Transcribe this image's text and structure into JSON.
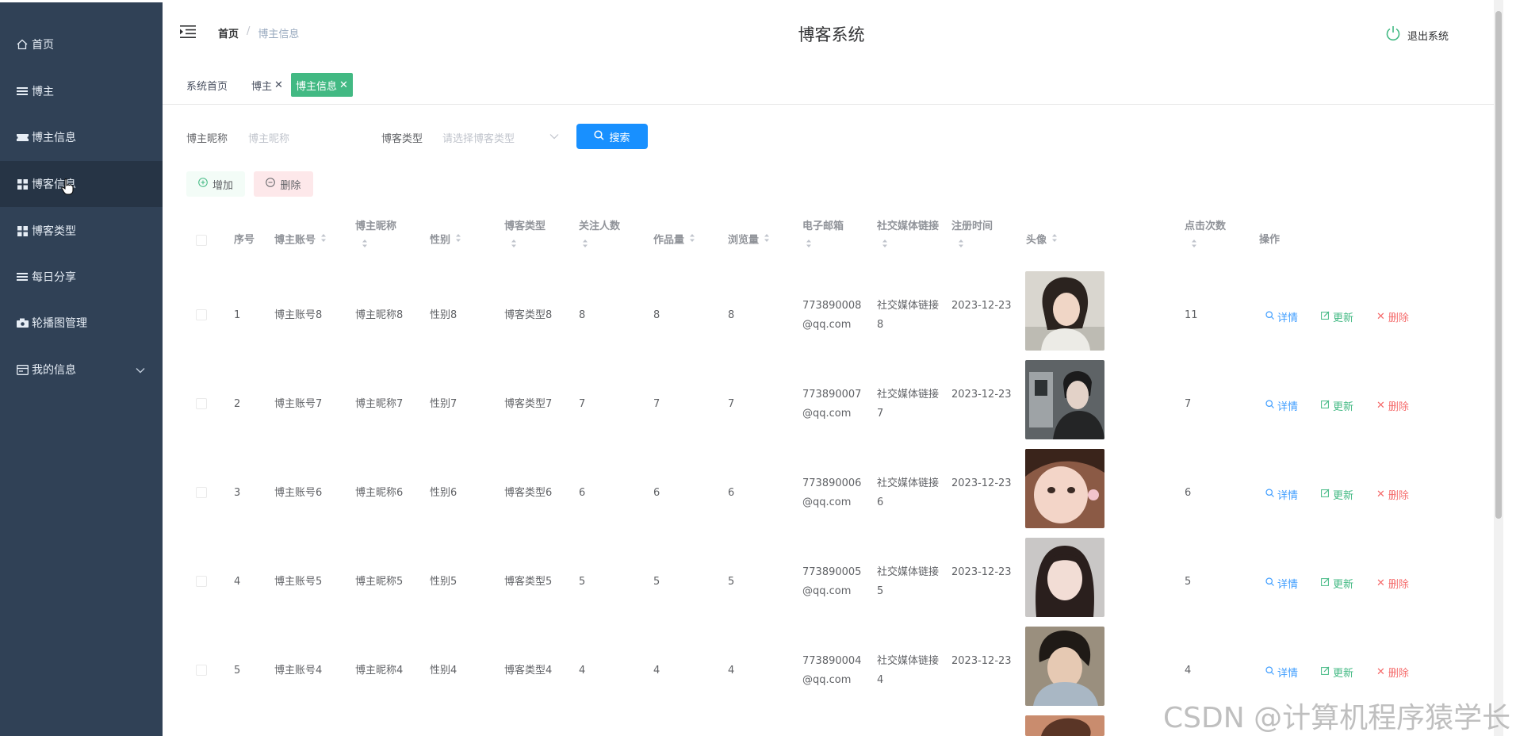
{
  "sidebar": {
    "items": [
      {
        "label": "首页",
        "icon": "home-icon"
      },
      {
        "label": "博主",
        "icon": "list-icon"
      },
      {
        "label": "博主信息",
        "icon": "ticket-icon"
      },
      {
        "label": "博客信息",
        "icon": "grid-icon",
        "active": true
      },
      {
        "label": "博客类型",
        "icon": "grid-icon"
      },
      {
        "label": "每日分享",
        "icon": "list-icon"
      },
      {
        "label": "轮播图管理",
        "icon": "camera-icon"
      },
      {
        "label": "我的信息",
        "icon": "card-icon",
        "expandable": true
      }
    ]
  },
  "header": {
    "breadcrumb_home": "首页",
    "breadcrumb_sep": "/",
    "breadcrumb_current": "博主信息",
    "title": "博客系统",
    "logout": "退出系统"
  },
  "tabs": [
    {
      "label": "系统首页",
      "closable": false
    },
    {
      "label": "博主",
      "closable": true
    },
    {
      "label": "博主信息",
      "closable": true,
      "active": true
    }
  ],
  "search": {
    "nickname_label": "博主昵称",
    "nickname_placeholder": "博主昵称",
    "type_label": "博客类型",
    "type_placeholder": "请选择博客类型",
    "search_button": "搜索"
  },
  "actions": {
    "add": "增加",
    "delete": "删除"
  },
  "table": {
    "headers": {
      "index": "序号",
      "account": "博主账号",
      "nickname": "博主昵称",
      "gender": "性别",
      "blog_type": "博客类型",
      "followers": "关注人数",
      "works": "作品量",
      "views": "浏览量",
      "email": "电子邮箱",
      "social": "社交媒体链接",
      "reg_time": "注册时间",
      "avatar": "头像",
      "clicks": "点击次数",
      "ops": "操作"
    },
    "op_labels": {
      "detail": "详情",
      "update": "更新",
      "remove": "删除"
    },
    "rows": [
      {
        "index": "1",
        "account": "博主账号8",
        "nickname": "博主昵称8",
        "gender": "性别8",
        "blog_type": "博客类型8",
        "followers": "8",
        "works": "8",
        "views": "8",
        "email": "773890008@qq.com",
        "social": "社交媒体链接8",
        "reg_time": "2023-12-23",
        "clicks": "11"
      },
      {
        "index": "2",
        "account": "博主账号7",
        "nickname": "博主昵称7",
        "gender": "性别7",
        "blog_type": "博客类型7",
        "followers": "7",
        "works": "7",
        "views": "7",
        "email": "773890007@qq.com",
        "social": "社交媒体链接7",
        "reg_time": "2023-12-23",
        "clicks": "7"
      },
      {
        "index": "3",
        "account": "博主账号6",
        "nickname": "博主昵称6",
        "gender": "性别6",
        "blog_type": "博客类型6",
        "followers": "6",
        "works": "6",
        "views": "6",
        "email": "773890006@qq.com",
        "social": "社交媒体链接6",
        "reg_time": "2023-12-23",
        "clicks": "6"
      },
      {
        "index": "4",
        "account": "博主账号5",
        "nickname": "博主昵称5",
        "gender": "性别5",
        "blog_type": "博客类型5",
        "followers": "5",
        "works": "5",
        "views": "5",
        "email": "773890005@qq.com",
        "social": "社交媒体链接5",
        "reg_time": "2023-12-23",
        "clicks": "5"
      },
      {
        "index": "5",
        "account": "博主账号4",
        "nickname": "博主昵称4",
        "gender": "性别4",
        "blog_type": "博客类型4",
        "followers": "4",
        "works": "4",
        "views": "4",
        "email": "773890004@qq.com",
        "social": "社交媒体链接4",
        "reg_time": "2023-12-23",
        "clicks": "4"
      }
    ]
  },
  "watermark": "CSDN @计算机程序猿学长",
  "colors": {
    "sidebar_bg": "#304156",
    "sidebar_active": "#263445",
    "accent_green": "#42b983",
    "primary_blue": "#1890ff",
    "danger": "#f56c6c"
  }
}
